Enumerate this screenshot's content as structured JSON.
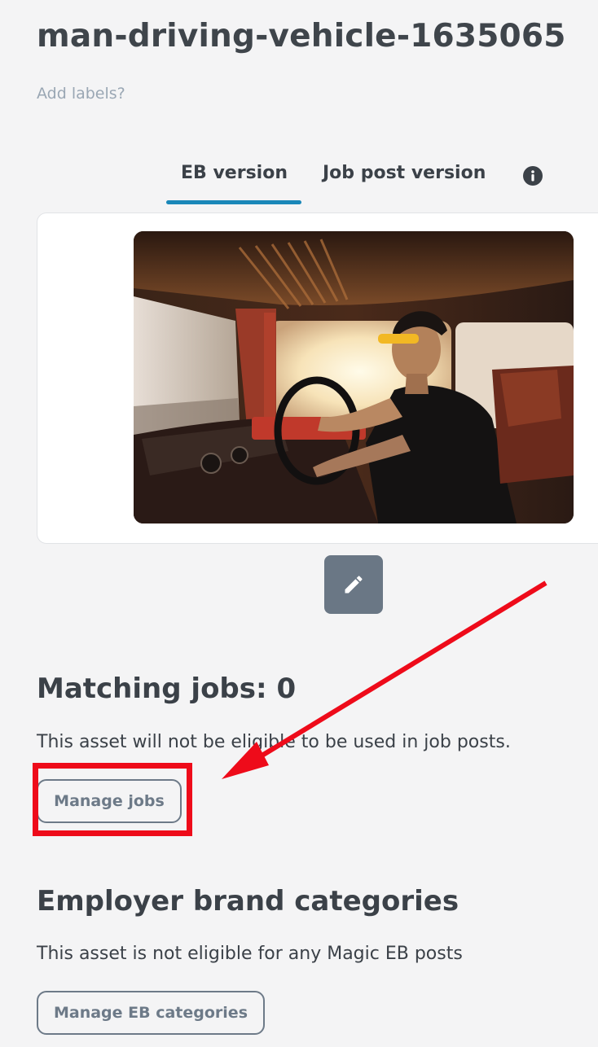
{
  "asset": {
    "title": "man-driving-vehicle-1635065",
    "add_labels_link": "Add labels?"
  },
  "tabs": [
    {
      "label": "EB version",
      "active": true
    },
    {
      "label": "Job post version",
      "active": false
    }
  ],
  "icons": {
    "info": "info-icon",
    "edit": "pencil-icon"
  },
  "matching_jobs": {
    "title": "Matching jobs: 0",
    "description": "This asset will not be eligible to be used in job posts.",
    "button_label": "Manage jobs"
  },
  "eb_categories": {
    "title": "Employer brand categories",
    "description": "This asset is not eligible for any Magic EB posts",
    "button_label": "Manage EB categories"
  },
  "colors": {
    "tab_underline": "#1a87b8",
    "annotation_red": "#ee0b1a",
    "edit_button": "#6a7785"
  }
}
